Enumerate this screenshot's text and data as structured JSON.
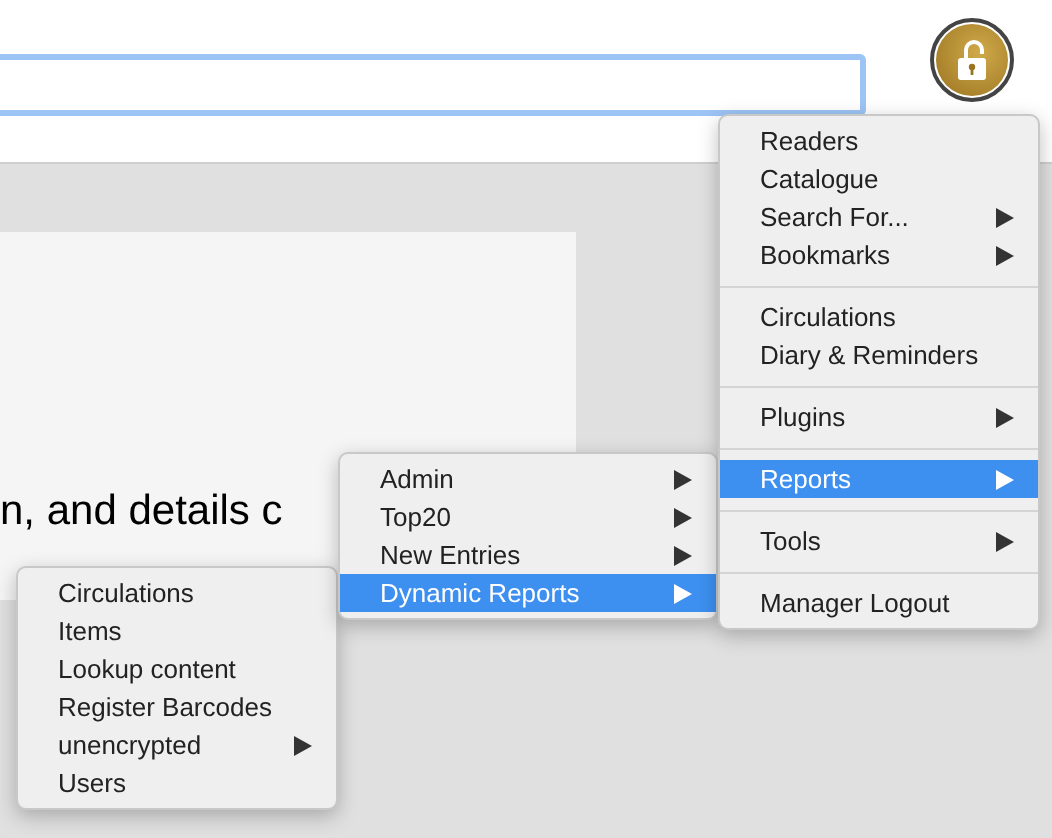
{
  "page_text": "n, and details c",
  "menus": [
    {
      "items": [
        {
          "kind": "item",
          "label": "Circulations",
          "submenu": false,
          "selected": false
        },
        {
          "kind": "item",
          "label": "Items",
          "submenu": false,
          "selected": false
        },
        {
          "kind": "item",
          "label": "Lookup content",
          "submenu": false,
          "selected": false
        },
        {
          "kind": "item",
          "label": "Register Barcodes",
          "submenu": false,
          "selected": false
        },
        {
          "kind": "item",
          "label": "unencrypted",
          "submenu": true,
          "selected": false
        },
        {
          "kind": "item",
          "label": "Users",
          "submenu": false,
          "selected": false
        }
      ]
    },
    {
      "items": [
        {
          "kind": "item",
          "label": "Admin",
          "submenu": true,
          "selected": false
        },
        {
          "kind": "item",
          "label": "Top20",
          "submenu": true,
          "selected": false
        },
        {
          "kind": "item",
          "label": "New Entries",
          "submenu": true,
          "selected": false
        },
        {
          "kind": "item",
          "label": "Dynamic Reports",
          "submenu": true,
          "selected": true
        }
      ]
    },
    {
      "items": [
        {
          "kind": "item",
          "label": "Readers",
          "submenu": false,
          "selected": false
        },
        {
          "kind": "item",
          "label": "Catalogue",
          "submenu": false,
          "selected": false
        },
        {
          "kind": "item",
          "label": "Search For...",
          "submenu": true,
          "selected": false
        },
        {
          "kind": "item",
          "label": "Bookmarks",
          "submenu": true,
          "selected": false
        },
        {
          "kind": "separator"
        },
        {
          "kind": "item",
          "label": "Circulations",
          "submenu": false,
          "selected": false
        },
        {
          "kind": "item",
          "label": "Diary & Reminders",
          "submenu": false,
          "selected": false
        },
        {
          "kind": "separator"
        },
        {
          "kind": "item",
          "label": "Plugins",
          "submenu": true,
          "selected": false
        },
        {
          "kind": "separator"
        },
        {
          "kind": "item",
          "label": "Reports",
          "submenu": true,
          "selected": true
        },
        {
          "kind": "separator"
        },
        {
          "kind": "item",
          "label": "Tools",
          "submenu": true,
          "selected": false
        },
        {
          "kind": "separator"
        },
        {
          "kind": "item",
          "label": "Manager Logout",
          "submenu": false,
          "selected": false
        }
      ]
    }
  ]
}
